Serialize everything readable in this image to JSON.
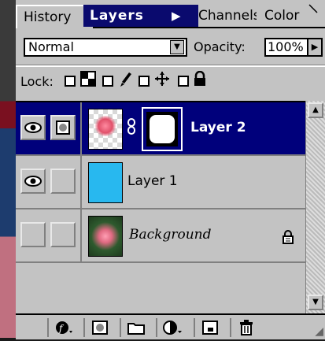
{
  "tabs": [
    "History",
    "Layers",
    "Channels",
    "Color"
  ],
  "active_tab_arrow": "▶",
  "blend_mode": "Normal",
  "opacity_label": "Opacity:",
  "opacity_value": "100%",
  "lock_label": "Lock:",
  "layers": [
    {
      "name": "Layer 2",
      "selected": true,
      "visible": true
    },
    {
      "name": "Layer 1",
      "selected": false,
      "visible": true
    },
    {
      "name": "Background",
      "selected": false,
      "visible": false,
      "locked": true
    }
  ],
  "colors": {
    "selection": "#00007b",
    "panel": "#c3c3c3",
    "layer1_fill": "#28b8ef"
  },
  "icons": {
    "eye": "eye-icon",
    "mask_link": "chain-link-icon",
    "lock": "padlock-icon",
    "bottom": [
      "layer-style-icon",
      "add-mask-icon",
      "new-set-icon",
      "adjustment-layer-icon",
      "new-layer-icon",
      "trash-icon"
    ]
  }
}
